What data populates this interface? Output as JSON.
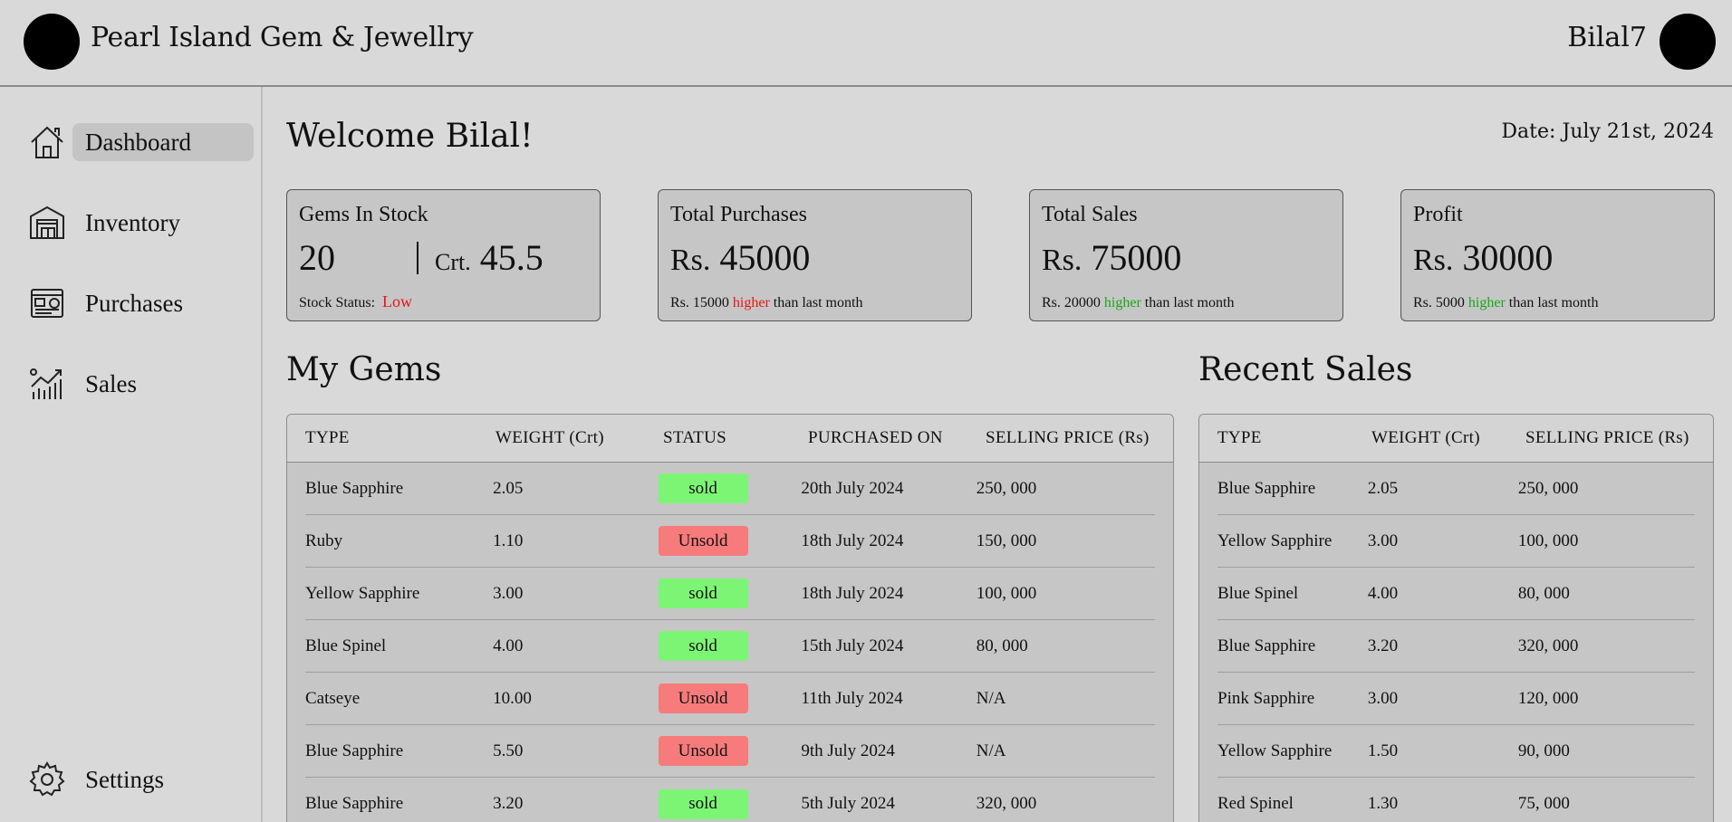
{
  "header": {
    "brand": "Pearl Island Gem & Jewellry",
    "user": "Bilal7"
  },
  "sidebar": {
    "items": [
      {
        "label": "Dashboard",
        "icon": "home-icon"
      },
      {
        "label": "Inventory",
        "icon": "warehouse-icon"
      },
      {
        "label": "Purchases",
        "icon": "invoice-icon"
      },
      {
        "label": "Sales",
        "icon": "chart-growth-icon"
      }
    ],
    "settings": "Settings"
  },
  "main": {
    "welcome": "Welcome Bilal!",
    "date": "Date: July 21st, 2024"
  },
  "cards": {
    "stock": {
      "title": "Gems In Stock",
      "count": "20",
      "crt_label": "Crt.",
      "crt_value": "45.5",
      "status_label": "Stock Status:",
      "status_value": "Low"
    },
    "purchases": {
      "title": "Total Purchases",
      "currency": "Rs.",
      "value": "45000",
      "foot_amount": "Rs. 15000",
      "foot_word": "higher",
      "foot_rest": "than last month"
    },
    "sales": {
      "title": "Total Sales",
      "currency": "Rs.",
      "value": "75000",
      "foot_amount": "Rs. 20000",
      "foot_word": "higher",
      "foot_rest": "than last month"
    },
    "profit": {
      "title": "Profit",
      "currency": "Rs.",
      "value": "30000",
      "foot_amount": "Rs. 5000",
      "foot_word": "higher",
      "foot_rest": "than last month"
    }
  },
  "colors": {
    "sold": "#7cf574",
    "unsold": "#f77b7b",
    "up_red": "#e81515",
    "up_green": "#18a818"
  },
  "my_gems": {
    "title": "My Gems",
    "headers": [
      "TYPE",
      "WEIGHT (Crt)",
      "STATUS",
      "PURCHASED ON",
      "SELLING PRICE (Rs)"
    ],
    "rows": [
      [
        "Blue Sapphire",
        "2.05",
        "sold",
        "20th July 2024",
        "250, 000"
      ],
      [
        "Ruby",
        "1.10",
        "Unsold",
        "18th July 2024",
        "150, 000"
      ],
      [
        "Yellow Sapphire",
        "3.00",
        "sold",
        "18th July 2024",
        "100, 000"
      ],
      [
        "Blue Spinel",
        "4.00",
        "sold",
        "15th July 2024",
        "80, 000"
      ],
      [
        "Catseye",
        "10.00",
        "Unsold",
        "11th July 2024",
        "N/A"
      ],
      [
        "Blue Sapphire",
        "5.50",
        "Unsold",
        "9th July 2024",
        "N/A"
      ],
      [
        "Blue Sapphire",
        "3.20",
        "sold",
        "5th July 2024",
        "320, 000"
      ]
    ]
  },
  "recent_sales": {
    "title": "Recent Sales",
    "headers": [
      "TYPE",
      "WEIGHT (Crt)",
      "SELLING PRICE (Rs)"
    ],
    "rows": [
      [
        "Blue Sapphire",
        "2.05",
        "250, 000"
      ],
      [
        "Yellow Sapphire",
        "3.00",
        "100, 000"
      ],
      [
        "Blue Spinel",
        "4.00",
        "80, 000"
      ],
      [
        "Blue Sapphire",
        "3.20",
        "320, 000"
      ],
      [
        "Pink Sapphire",
        "3.00",
        "120, 000"
      ],
      [
        "Yellow Sapphire",
        "1.50",
        "90, 000"
      ],
      [
        "Red Spinel",
        "1.30",
        "75, 000"
      ]
    ]
  }
}
